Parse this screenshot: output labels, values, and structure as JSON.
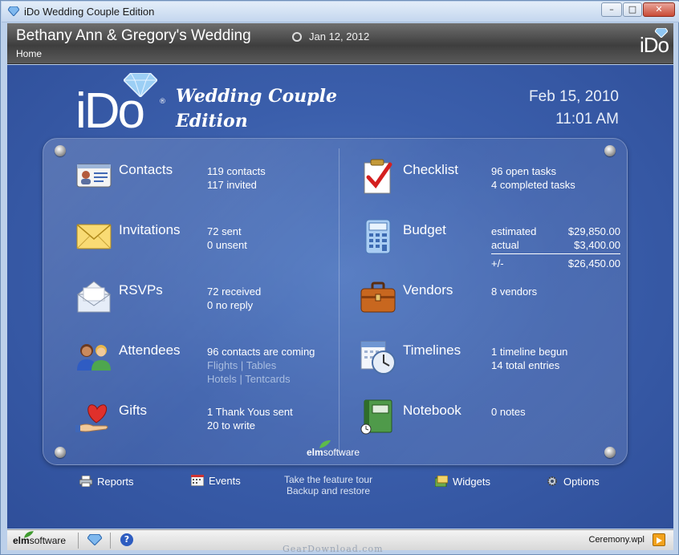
{
  "window": {
    "title": "iDo Wedding Couple Edition",
    "minimize": "–",
    "maximize": "□",
    "close": "✕"
  },
  "header": {
    "wedding_title": "Bethany Ann & Gregory's Wedding",
    "wedding_date": "Jan 12, 2012",
    "breadcrumb": "Home",
    "logo": "iDo"
  },
  "branding": {
    "logo": "iDo",
    "registered": "®",
    "edition_line1": "Wedding Couple",
    "edition_line2": "Edition",
    "company_prefix": "elm",
    "company_suffix": "software"
  },
  "clock": {
    "date": "Feb 15, 2010",
    "time": "11:01 AM"
  },
  "modules_left": [
    {
      "label": "Contacts",
      "icon": "contacts-card-icon",
      "lines": [
        "119 contacts",
        "117 invited"
      ]
    },
    {
      "label": "Invitations",
      "icon": "envelope-icon",
      "lines": [
        "72 sent",
        "0 unsent"
      ]
    },
    {
      "label": "RSVPs",
      "icon": "open-envelope-icon",
      "lines": [
        "72 received",
        "0 no reply"
      ]
    },
    {
      "label": "Attendees",
      "icon": "people-icon",
      "lines": [
        "96 contacts are coming"
      ],
      "links": [
        "Flights",
        "Tables",
        "Hotels",
        "Tentcards"
      ],
      "link_sep": "|"
    },
    {
      "label": "Gifts",
      "icon": "heart-hand-icon",
      "lines": [
        "1 Thank Yous sent",
        "20 to write"
      ]
    }
  ],
  "modules_right": [
    {
      "label": "Checklist",
      "icon": "checklist-icon",
      "lines": [
        "96 open tasks",
        "4 completed tasks"
      ]
    },
    {
      "label": "Budget",
      "icon": "calculator-icon",
      "budget": {
        "estimated_label": "estimated",
        "estimated": "$29,850.00",
        "actual_label": "actual",
        "actual": "$3,400.00",
        "diff_label": "+/-",
        "diff": "$26,450.00"
      }
    },
    {
      "label": "Vendors",
      "icon": "briefcase-icon",
      "lines": [
        "8 vendors"
      ]
    },
    {
      "label": "Timelines",
      "icon": "calendar-clock-icon",
      "lines": [
        "1 timeline begun",
        "14 total entries"
      ]
    },
    {
      "label": "Notebook",
      "icon": "notebook-icon",
      "lines": [
        "0 notes"
      ]
    }
  ],
  "bottom_nav": {
    "reports": "Reports",
    "events": "Events",
    "tour": "Take the feature tour",
    "backup": "Backup and restore",
    "widgets": "Widgets",
    "options": "Options"
  },
  "status_bar": {
    "company_prefix": "elm",
    "company_suffix": "software",
    "help": "?",
    "file": "Ceremony.wpl"
  },
  "watermark": "GearDownload.com",
  "colors": {
    "background": "#3b5fac",
    "header": "#4a4a4a",
    "accent_red": "#d32a2a"
  }
}
